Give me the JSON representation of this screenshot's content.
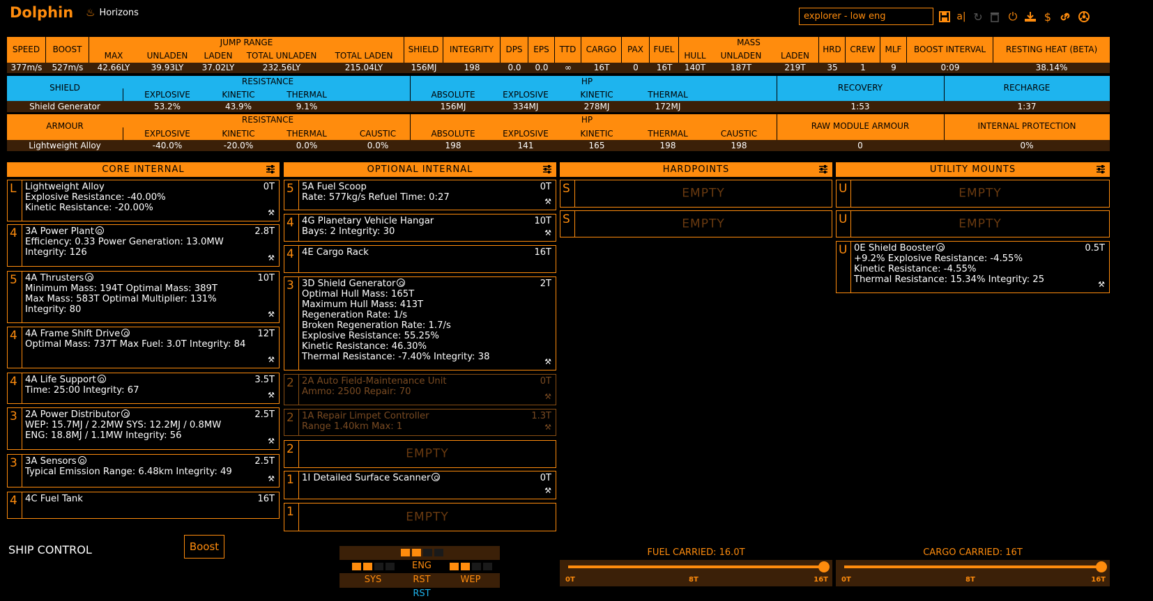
{
  "header": {
    "title": "Dolphin",
    "game": "Horizons",
    "build_name": "explorer - low eng",
    "icons": [
      "save-icon",
      "rename-icon",
      "reload-icon",
      "delete-icon",
      "power-icon",
      "export-icon",
      "dollar-icon",
      "link-icon",
      "settings-icon"
    ]
  },
  "summary": {
    "headers": {
      "speed": "SPEED",
      "boost": "BOOST",
      "jump_range": "JUMP RANGE",
      "jr_max": "MAX",
      "jr_unladen": "UNLADEN",
      "jr_laden": "LADEN",
      "jr_total_unladen": "TOTAL UNLADEN",
      "jr_total_laden": "TOTAL LADEN",
      "shield": "SHIELD",
      "integrity": "INTEGRITY",
      "dps": "DPS",
      "eps": "EPS",
      "ttd": "TTD",
      "cargo": "CARGO",
      "pax": "PAX",
      "fuel": "FUEL",
      "mass": "MASS",
      "m_hull": "HULL",
      "m_unladen": "UNLADEN",
      "m_laden": "LADEN",
      "hrd": "HRD",
      "crew": "CREW",
      "mlf": "MLF",
      "boost_interval": "BOOST INTERVAL",
      "resting_heat": "RESTING HEAT (BETA)"
    },
    "values": {
      "speed": "377m/s",
      "boost": "527m/s",
      "jr_max": "42.66LY",
      "jr_unladen": "39.93LY",
      "jr_laden": "37.02LY",
      "jr_total_unladen": "232.56LY",
      "jr_total_laden": "215.04LY",
      "shield": "156MJ",
      "integrity": "198",
      "dps": "0.0",
      "eps": "0.0",
      "ttd": "∞",
      "cargo": "16T",
      "pax": "0",
      "fuel": "16T",
      "m_hull": "140T",
      "m_unladen": "187T",
      "m_laden": "219T",
      "hrd": "35",
      "crew": "1",
      "mlf": "9",
      "boost_interval": "0:09",
      "resting_heat": "38.14%"
    }
  },
  "shield_table": {
    "col_label": "SHIELD",
    "resistance": "RESISTANCE",
    "explosive": "EXPLOSIVE",
    "kinetic": "KINETIC",
    "thermal": "THERMAL",
    "hp": "HP",
    "absolute": "ABSOLUTE",
    "hp_explosive": "EXPLOSIVE",
    "hp_kinetic": "KINETIC",
    "hp_thermal": "THERMAL",
    "recovery": "RECOVERY",
    "recharge": "RECHARGE",
    "row_name": "Shield Generator",
    "r_exp": "53.2%",
    "r_kin": "43.9%",
    "r_thm": "9.1%",
    "hp_abs": "156MJ",
    "hp_exp_v": "334MJ",
    "hp_kin_v": "278MJ",
    "hp_thm_v": "172MJ",
    "recovery_v": "1:53",
    "recharge_v": "1:37"
  },
  "armour_table": {
    "col_label": "ARMOUR",
    "resistance": "RESISTANCE",
    "explosive": "EXPLOSIVE",
    "kinetic": "KINETIC",
    "thermal": "THERMAL",
    "caustic": "CAUSTIC",
    "hp": "HP",
    "absolute": "ABSOLUTE",
    "hp_explosive": "EXPLOSIVE",
    "hp_kinetic": "KINETIC",
    "hp_thermal": "THERMAL",
    "hp_caustic": "CAUSTIC",
    "raw_module": "RAW MODULE ARMOUR",
    "internal_protection": "INTERNAL PROTECTION",
    "row_name": "Lightweight Alloy",
    "r_exp": "-40.0%",
    "r_kin": "-20.0%",
    "r_thm": "0.0%",
    "r_cau": "0.0%",
    "hp_abs": "198",
    "hp_exp_v": "141",
    "hp_kin_v": "165",
    "hp_thm_v": "198",
    "hp_cau_v": "198",
    "raw_module_v": "0",
    "internal_protection_v": "0%"
  },
  "sections": {
    "core": "CORE INTERNAL",
    "optional": "OPTIONAL INTERNAL",
    "hardpoints": "HARDPOINTS",
    "utility": "UTILITY MOUNTS"
  },
  "core_slots": [
    {
      "cls": "L",
      "mass": "0T",
      "lines": [
        "Lightweight Alloy",
        "Explosive Resistance: -40.00%",
        "Kinetic Resistance: -20.00%"
      ]
    },
    {
      "cls": "4",
      "mass": "2.8T",
      "lines": [
        "3A Power Plant",
        "Efficiency: 0.33   Power Generation: 13.0MW",
        "Integrity: 126"
      ]
    },
    {
      "cls": "5",
      "mass": "10T",
      "lines": [
        "4A Thrusters",
        "Minimum Mass: 194T   Optimal Mass: 389T",
        "Max Mass: 583T   Optimal Multiplier: 131%",
        "Integrity: 80"
      ]
    },
    {
      "cls": "4",
      "mass": "12T",
      "lines": [
        "4A Frame Shift Drive",
        "Optimal Mass: 737T   Max Fuel: 3.0T   Integrity: 84"
      ]
    },
    {
      "cls": "4",
      "mass": "3.5T",
      "lines": [
        "4A Life Support",
        "Time: 25:00   Integrity: 67"
      ]
    },
    {
      "cls": "3",
      "mass": "2.5T",
      "lines": [
        "2A Power Distributor",
        "WEP: 15.7MJ / 2.2MW   SYS: 12.2MJ / 0.8MW",
        "ENG: 18.8MJ / 1.1MW   Integrity: 56"
      ]
    },
    {
      "cls": "3",
      "mass": "2.5T",
      "lines": [
        "3A Sensors",
        "Typical Emission Range: 6.48km   Integrity: 49"
      ]
    },
    {
      "cls": "4",
      "mass": "16T",
      "lines": [
        "4C Fuel Tank"
      ]
    }
  ],
  "optional_slots": [
    {
      "cls": "5",
      "mass": "0T",
      "lines": [
        "5A Fuel Scoop",
        "Rate: 577kg/s   Refuel Time: 0:27"
      ]
    },
    {
      "cls": "4",
      "mass": "10T",
      "lines": [
        "4G Planetary Vehicle Hangar",
        "Bays: 2   Integrity: 30"
      ]
    },
    {
      "cls": "4",
      "mass": "16T",
      "lines": [
        "4E Cargo Rack"
      ]
    },
    {
      "cls": "3",
      "mass": "2T",
      "lines": [
        "3D Shield Generator",
        "Optimal Hull Mass: 165T",
        "Maximum Hull Mass: 413T",
        "Regeneration Rate: 1/s",
        "Broken Regeneration Rate: 1.7/s",
        "Explosive Resistance: 55.25%",
        "Kinetic Resistance: 46.30%",
        "Thermal Resistance: -7.40%   Integrity: 38"
      ]
    },
    {
      "cls": "2",
      "mass": "0T",
      "lines": [
        "2A Auto Field-Maintenance Unit",
        "Ammo: 2500   Repair: 70"
      ]
    },
    {
      "cls": "2",
      "mass": "1.3T",
      "lines": [
        "1A Repair Limpet Controller",
        "Range 1.40km   Max: 1"
      ]
    },
    {
      "cls": "2",
      "empty": "EMPTY"
    },
    {
      "cls": "1",
      "mass": "0T",
      "lines": [
        "1I Detailed Surface Scanner"
      ]
    },
    {
      "cls": "1",
      "empty": "EMPTY"
    }
  ],
  "hardpoints": [
    {
      "cls": "S",
      "empty": "EMPTY"
    },
    {
      "cls": "S",
      "empty": "EMPTY"
    }
  ],
  "utility": [
    {
      "cls": "U",
      "empty": "EMPTY"
    },
    {
      "cls": "U",
      "empty": "EMPTY"
    },
    {
      "cls": "U",
      "mass": "0.5T",
      "lines": [
        "0E Shield Booster",
        "+9.2%   Explosive Resistance: -4.55%",
        "Kinetic Resistance: -4.55%",
        "Thermal Resistance: 15.34%   Integrity: 25"
      ]
    }
  ],
  "bottom": {
    "ship_control": "SHIP CONTROL",
    "boost_label": "Boost",
    "pips": {
      "eng": "ENG",
      "sys": "SYS",
      "rst": "RST",
      "wep": "WEP",
      "rst_bottom": "RST",
      "eng_level": 2,
      "sys_level": 2,
      "wep_level": 2,
      "max": 4
    },
    "fuel": {
      "title": "FUEL CARRIED: 16.0T",
      "min": "0T",
      "mid": "8T",
      "max": "16T",
      "fraction": 1.0
    },
    "cargo": {
      "title": "CARGO CARRIED: 16T",
      "min": "0T",
      "mid": "8T",
      "max": "16T",
      "fraction": 1.0
    }
  },
  "colors": {
    "accent": "#ff8c0d",
    "shield_header": "#1eb4ee",
    "row_bg": "#3b2008"
  }
}
